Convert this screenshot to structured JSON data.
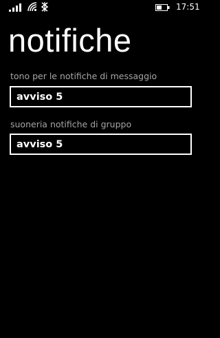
{
  "status_bar": {
    "time": "17:51",
    "icons": [
      "signal-icon",
      "wifi-icon",
      "data-icon",
      "battery-icon"
    ]
  },
  "page": {
    "title": "notifiche"
  },
  "settings": [
    {
      "label": "tono per le notifiche di messaggio",
      "value": "avviso 5"
    },
    {
      "label": "suoneria notifiche di gruppo",
      "value": "avviso 5"
    }
  ],
  "colors": {
    "background": "#000000",
    "foreground": "#ffffff",
    "label": "#a6a6a6"
  }
}
